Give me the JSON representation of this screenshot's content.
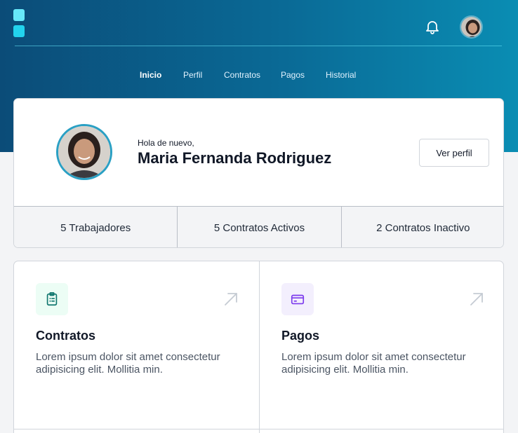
{
  "nav": {
    "items": [
      {
        "label": "Inicio",
        "active": true
      },
      {
        "label": "Perfil",
        "active": false
      },
      {
        "label": "Contratos",
        "active": false
      },
      {
        "label": "Pagos",
        "active": false
      },
      {
        "label": "Historial",
        "active": false
      }
    ]
  },
  "header": {
    "bell_icon": "bell-icon",
    "avatar": "user-avatar"
  },
  "profile": {
    "greeting": "Hola de nuevo,",
    "name": "Maria Fernanda Rodriguez",
    "button_label": "Ver perfil"
  },
  "stats": [
    {
      "label": "5 Trabajadores"
    },
    {
      "label": "5 Contratos Activos"
    },
    {
      "label": "2 Contratos Inactivo"
    }
  ],
  "cards": [
    {
      "title": "Contratos",
      "description": "Lorem ipsum dolor sit amet consectetur adipisicing elit. Mollitia min.",
      "icon": "clipboard-icon"
    },
    {
      "title": "Pagos",
      "description": "Lorem ipsum dolor sit amet consectetur adipisicing elit. Mollitia min.",
      "icon": "credit-card-icon"
    }
  ],
  "colors": {
    "header_gradient_start": "#0b4c78",
    "header_gradient_end": "#0a8db3",
    "logo_light": "#67e8f9",
    "logo_dark": "#22d3ee",
    "avatar_ring": "#2aa0c4",
    "teal_icon": "#0f766e",
    "purple_icon": "#7c3aed"
  }
}
